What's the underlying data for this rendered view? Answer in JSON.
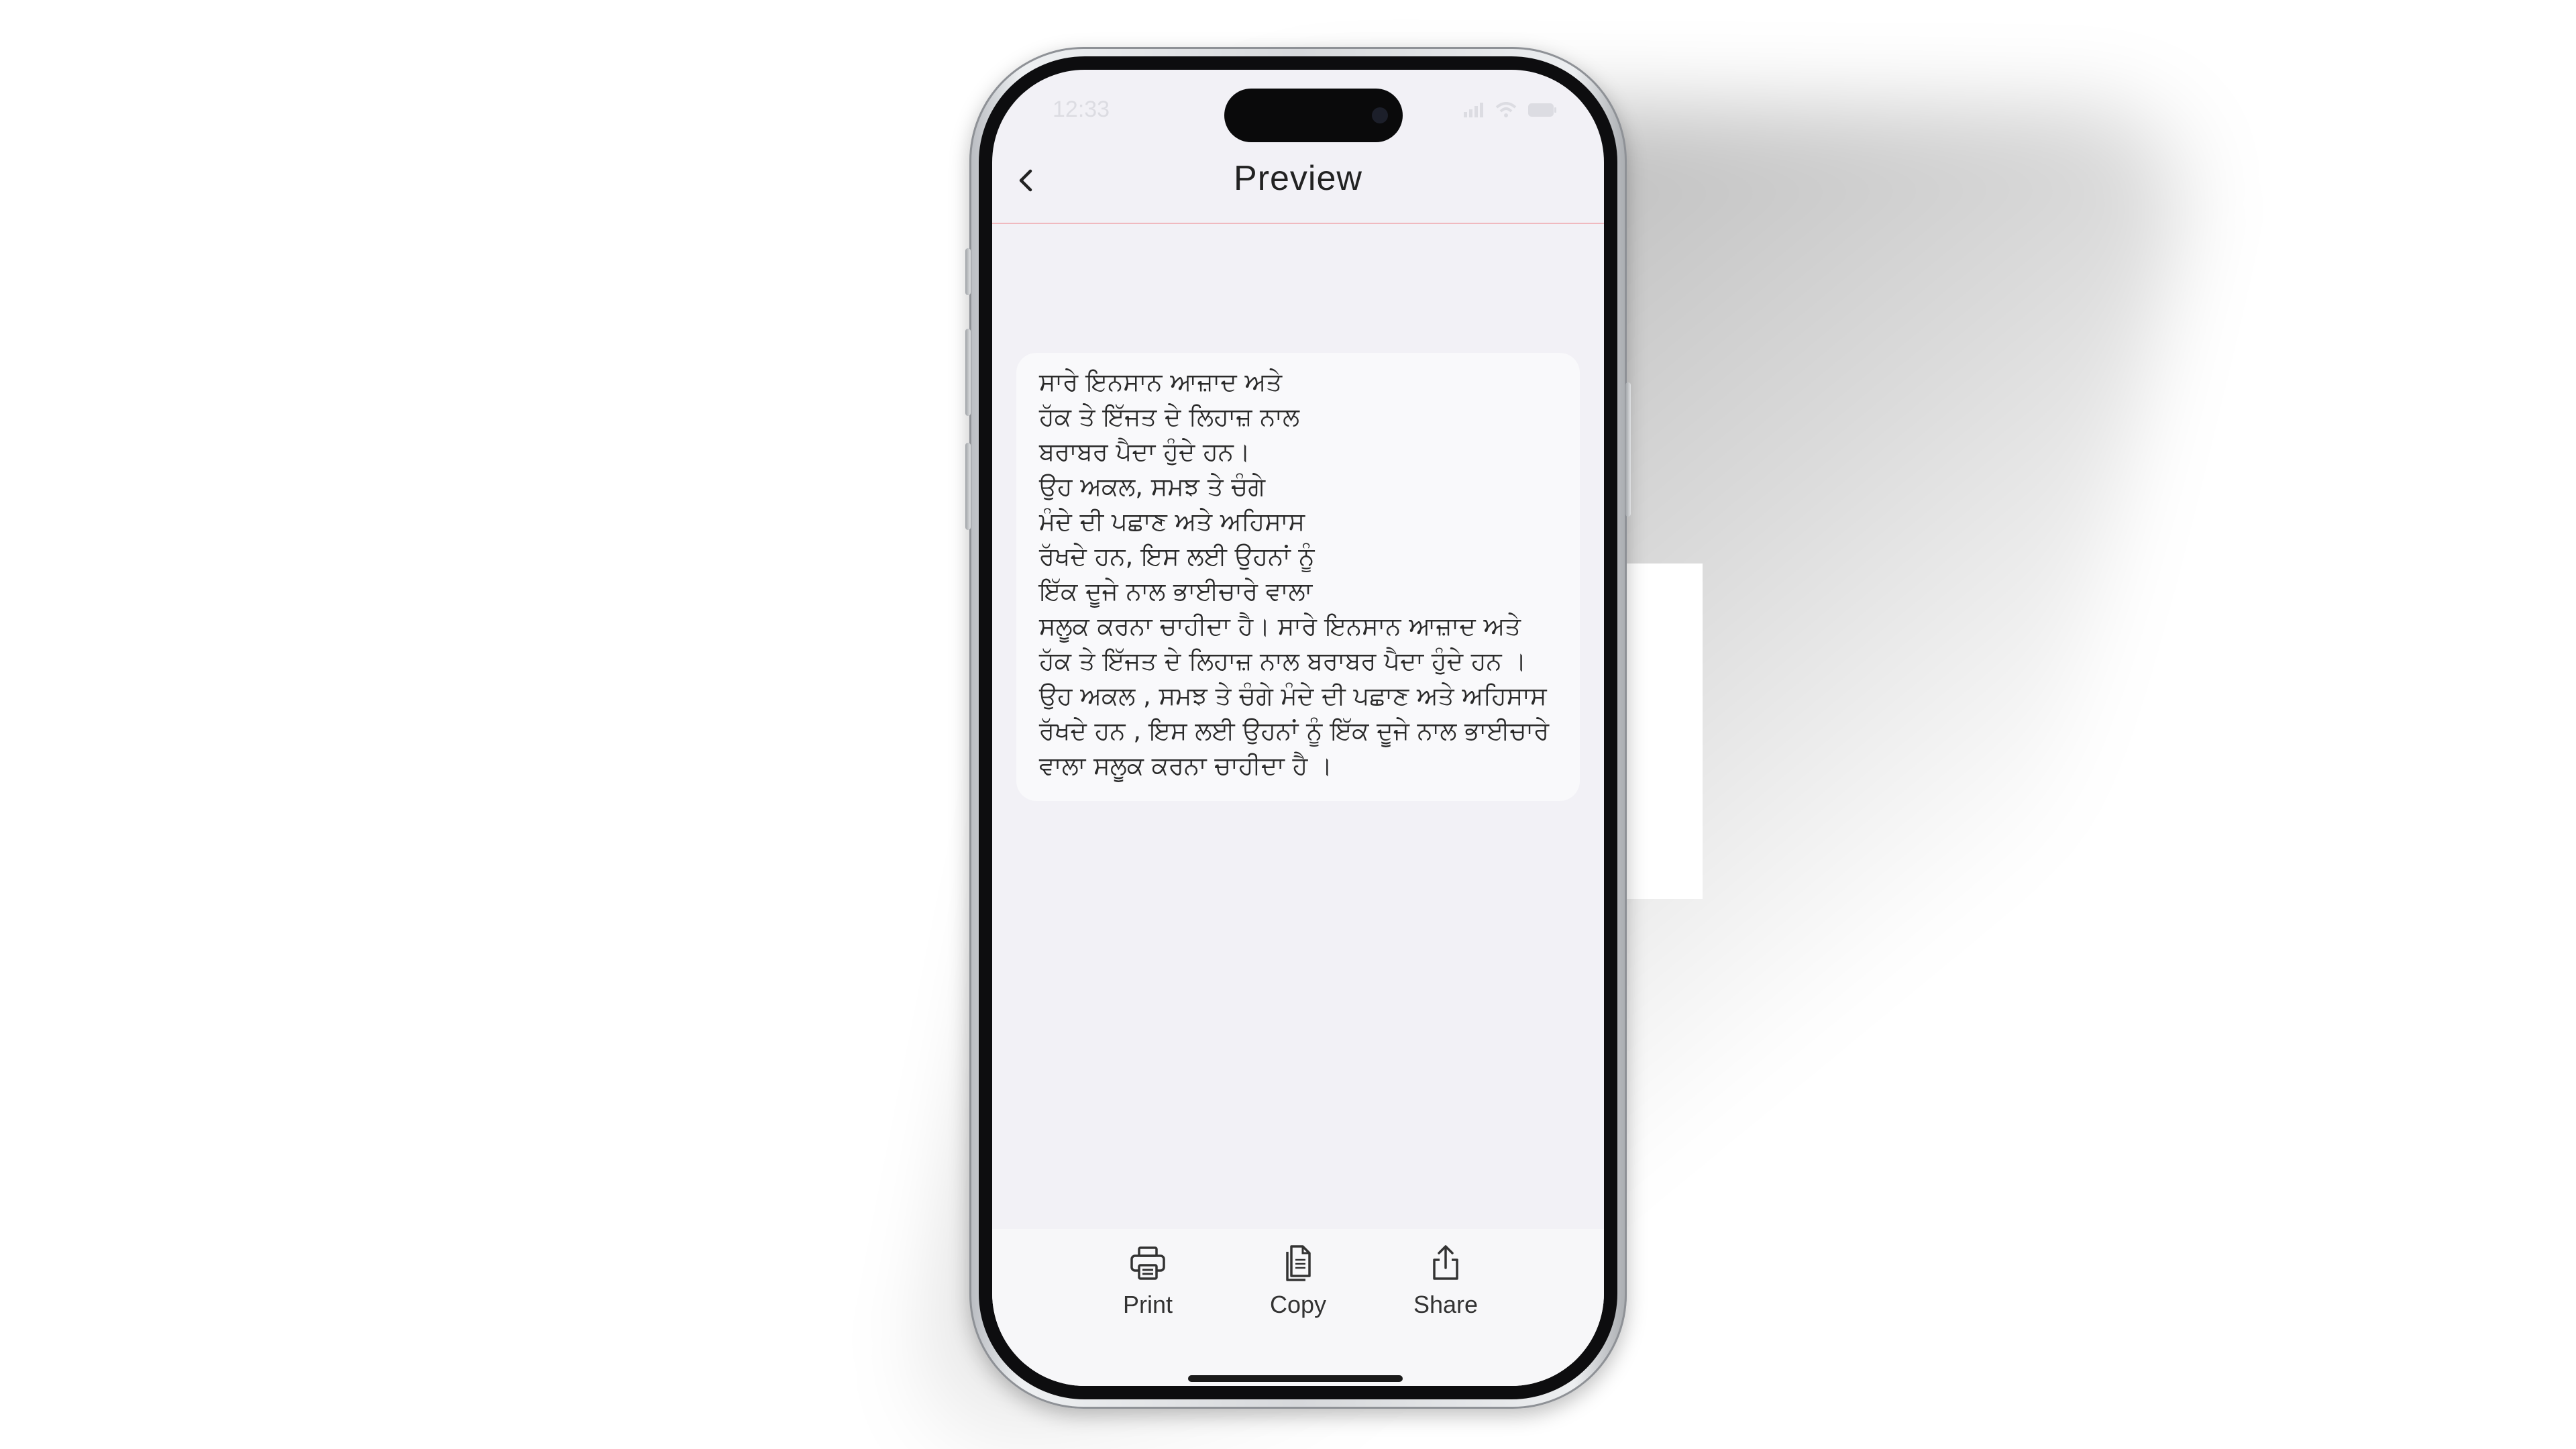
{
  "status_bar": {
    "time": "12:33",
    "icons": [
      "signal-icon",
      "wifi-icon",
      "battery-icon"
    ]
  },
  "nav": {
    "title": "Preview",
    "back_icon": "chevron-left-icon"
  },
  "content": {
    "text": "ਸਾਰੇ ਇਨਸਾਨ ਆਜ਼ਾਦ ਅਤੇ\nਹੱਕ ਤੇ ਇੱਜਤ ਦੇ ਲਿਹਾਜ਼ ਨਾਲ\nਬਰਾਬਰ ਪੈਦਾ ਹੁੰਦੇ ਹਨ।\nਉਹ ਅਕਲ, ਸਮਝ ਤੇ ਚੰਗੇ\nਮੰਦੇ ਦੀ ਪਛਾਣ ਅਤੇ ਅਹਿਸਾਸ\nਰੱਖਦੇ ਹਨ, ਇਸ ਲਈ ਉਹਨਾਂ ਨੂੰ\nਇੱਕ ਦੂਜੇ ਨਾਲ ਭਾਈਚਾਰੇ ਵਾਲਾ\nਸਲੂਕ ਕਰਨਾ ਚਾਹੀਦਾ ਹੈ। ਸਾਰੇ ਇਨਸਾਨ ਆਜ਼ਾਦ ਅਤੇ ਹੱਕ ਤੇ ਇੱਜਤ ਦੇ ਲਿਹਾਜ਼ ਨਾਲ ਬਰਾਬਰ ਪੈਦਾ ਹੁੰਦੇ ਹਨ । ਉਹ ਅਕਲ , ਸਮਝ ਤੇ ਚੰਗੇ ਮੰਦੇ ਦੀ ਪਛਾਣ ਅਤੇ ਅਹਿਸਾਸ ਰੱਖਦੇ ਹਨ , ਇਸ ਲਈ ਉਹਨਾਂ ਨੂੰ ਇੱਕ ਦੂਜੇ ਨਾਲ ਭਾਈਚਾਰੇ ਵਾਲਾ ਸਲੂਕ ਕਰਨਾ ਚਾਹੀਦਾ ਹੈ ।"
  },
  "toolbar": {
    "items": [
      {
        "label": "Print",
        "icon": "printer-icon"
      },
      {
        "label": "Copy",
        "icon": "document-copy-icon"
      },
      {
        "label": "Share",
        "icon": "share-icon"
      }
    ]
  },
  "colors": {
    "screen_bg": "#f2f1f6",
    "nav_divider": "#f0b9bf",
    "card_bg": "#f9f9fb",
    "toolbar_bg": "#f7f7f9"
  }
}
